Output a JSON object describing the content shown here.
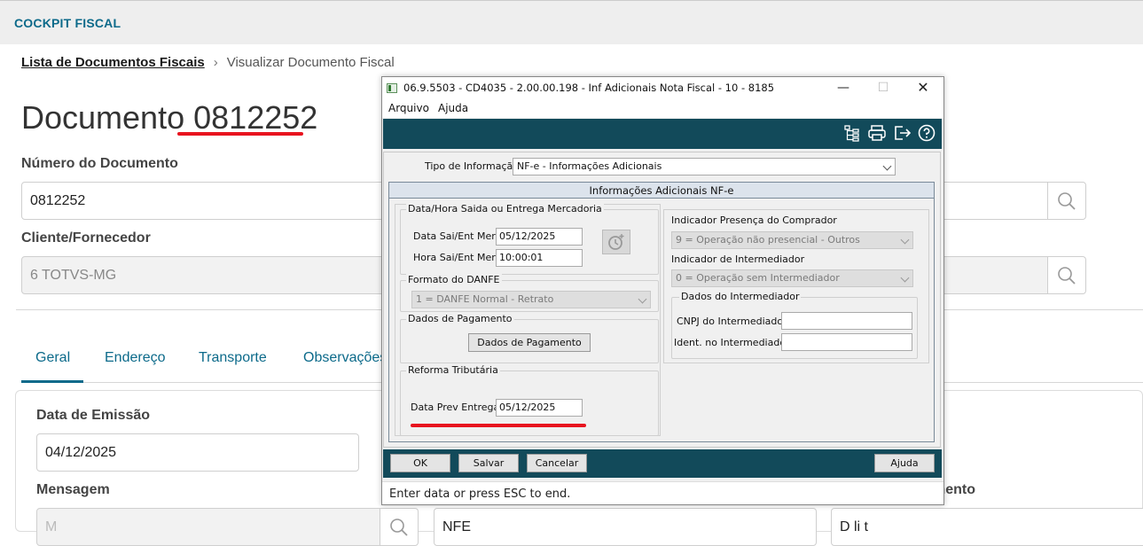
{
  "app": {
    "title": "COCKPIT FISCAL"
  },
  "breadcrumb": {
    "link": "Lista de Documentos Fiscais",
    "current": "Visualizar Documento Fiscal"
  },
  "document": {
    "title_prefix": "Documento",
    "number": "0812252"
  },
  "fields": {
    "numero_label": "Número do Documento",
    "numero_value": "0812252",
    "cliente_label": "Cliente/Fornecedor",
    "cliente_value": "6  TOTVS-MG",
    "data_emissao_label": "Data de Emissão",
    "data_emissao_value": "04/12/2025",
    "mensagem_label": "Mensagem",
    "mensagem_value": "M",
    "nfe_value": "NFE",
    "right_label_fragment": "mento",
    "right_value_fragment": "D  li   t"
  },
  "tabs": [
    "Geral",
    "Endereço",
    "Transporte",
    "Observações"
  ],
  "dialog": {
    "title": "06.9.5503 - CD4035 - 2.00.00.198 - Inf Adicionais Nota Fiscal - 10 - 8185",
    "menu": [
      "Arquivo",
      "Ajuda"
    ],
    "toolbar_icons": [
      "tree-icon",
      "printer-icon",
      "exit-icon",
      "help-icon"
    ],
    "tipo_label": "Tipo de Informação:",
    "tipo_value": "NF-e - Informações Adicionais",
    "panel_header": "Informações Adicionais NF-e",
    "grp_datahora": "Data/Hora Saida ou Entrega Mercadoria",
    "data_sai_label": "Data Sai/Ent Merc:",
    "data_sai_value": "05/12/2025",
    "hora_sai_label": "Hora Sai/Ent Merc:",
    "hora_sai_value": "10:00:01",
    "grp_danfe": "Formato do DANFE",
    "danfe_value": "1 = DANFE Normal - Retrato",
    "grp_pagamento": "Dados de Pagamento",
    "btn_pagamento": "Dados de Pagamento",
    "grp_reforma": "Reforma Tributária",
    "data_prev_label": "Data Prev Entrega:",
    "data_prev_value": "05/12/2025",
    "indicador_presenca_label": "Indicador Presença do Comprador",
    "indicador_presenca_value": "9 = Operação não presencial - Outros",
    "indicador_intermed_label": "Indicador de Intermediador",
    "indicador_intermed_value": "0 = Operação sem Intermediador",
    "grp_intermed": "Dados do Intermediador",
    "cnpj_label": "CNPJ do Intermediador:",
    "ident_label": "Ident. no Intermediador:",
    "btn_ok": "OK",
    "btn_salvar": "Salvar",
    "btn_cancelar": "Cancelar",
    "btn_ajuda": "Ajuda",
    "status": "Enter data or press ESC to end."
  },
  "colors": {
    "accent": "#0c6a8a",
    "toolbar": "#124a5a",
    "highlight": "#e8141f"
  }
}
